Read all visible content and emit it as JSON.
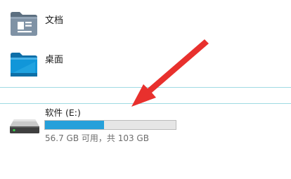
{
  "folders": [
    {
      "label": "文档",
      "icon": "documents-folder-icon"
    },
    {
      "label": "桌面",
      "icon": "desktop-folder-icon"
    }
  ],
  "drive": {
    "label": "软件 (E:)",
    "space_text": "56.7 GB 可用，共 103 GB",
    "free_gb": 56.7,
    "total_gb": 103,
    "used_fraction": 0.4495,
    "icon": "hard-drive-icon",
    "bar_color": "#26a0da"
  },
  "annotation": {
    "icon": "red-arrow-annotation",
    "color": "#e8302d"
  }
}
